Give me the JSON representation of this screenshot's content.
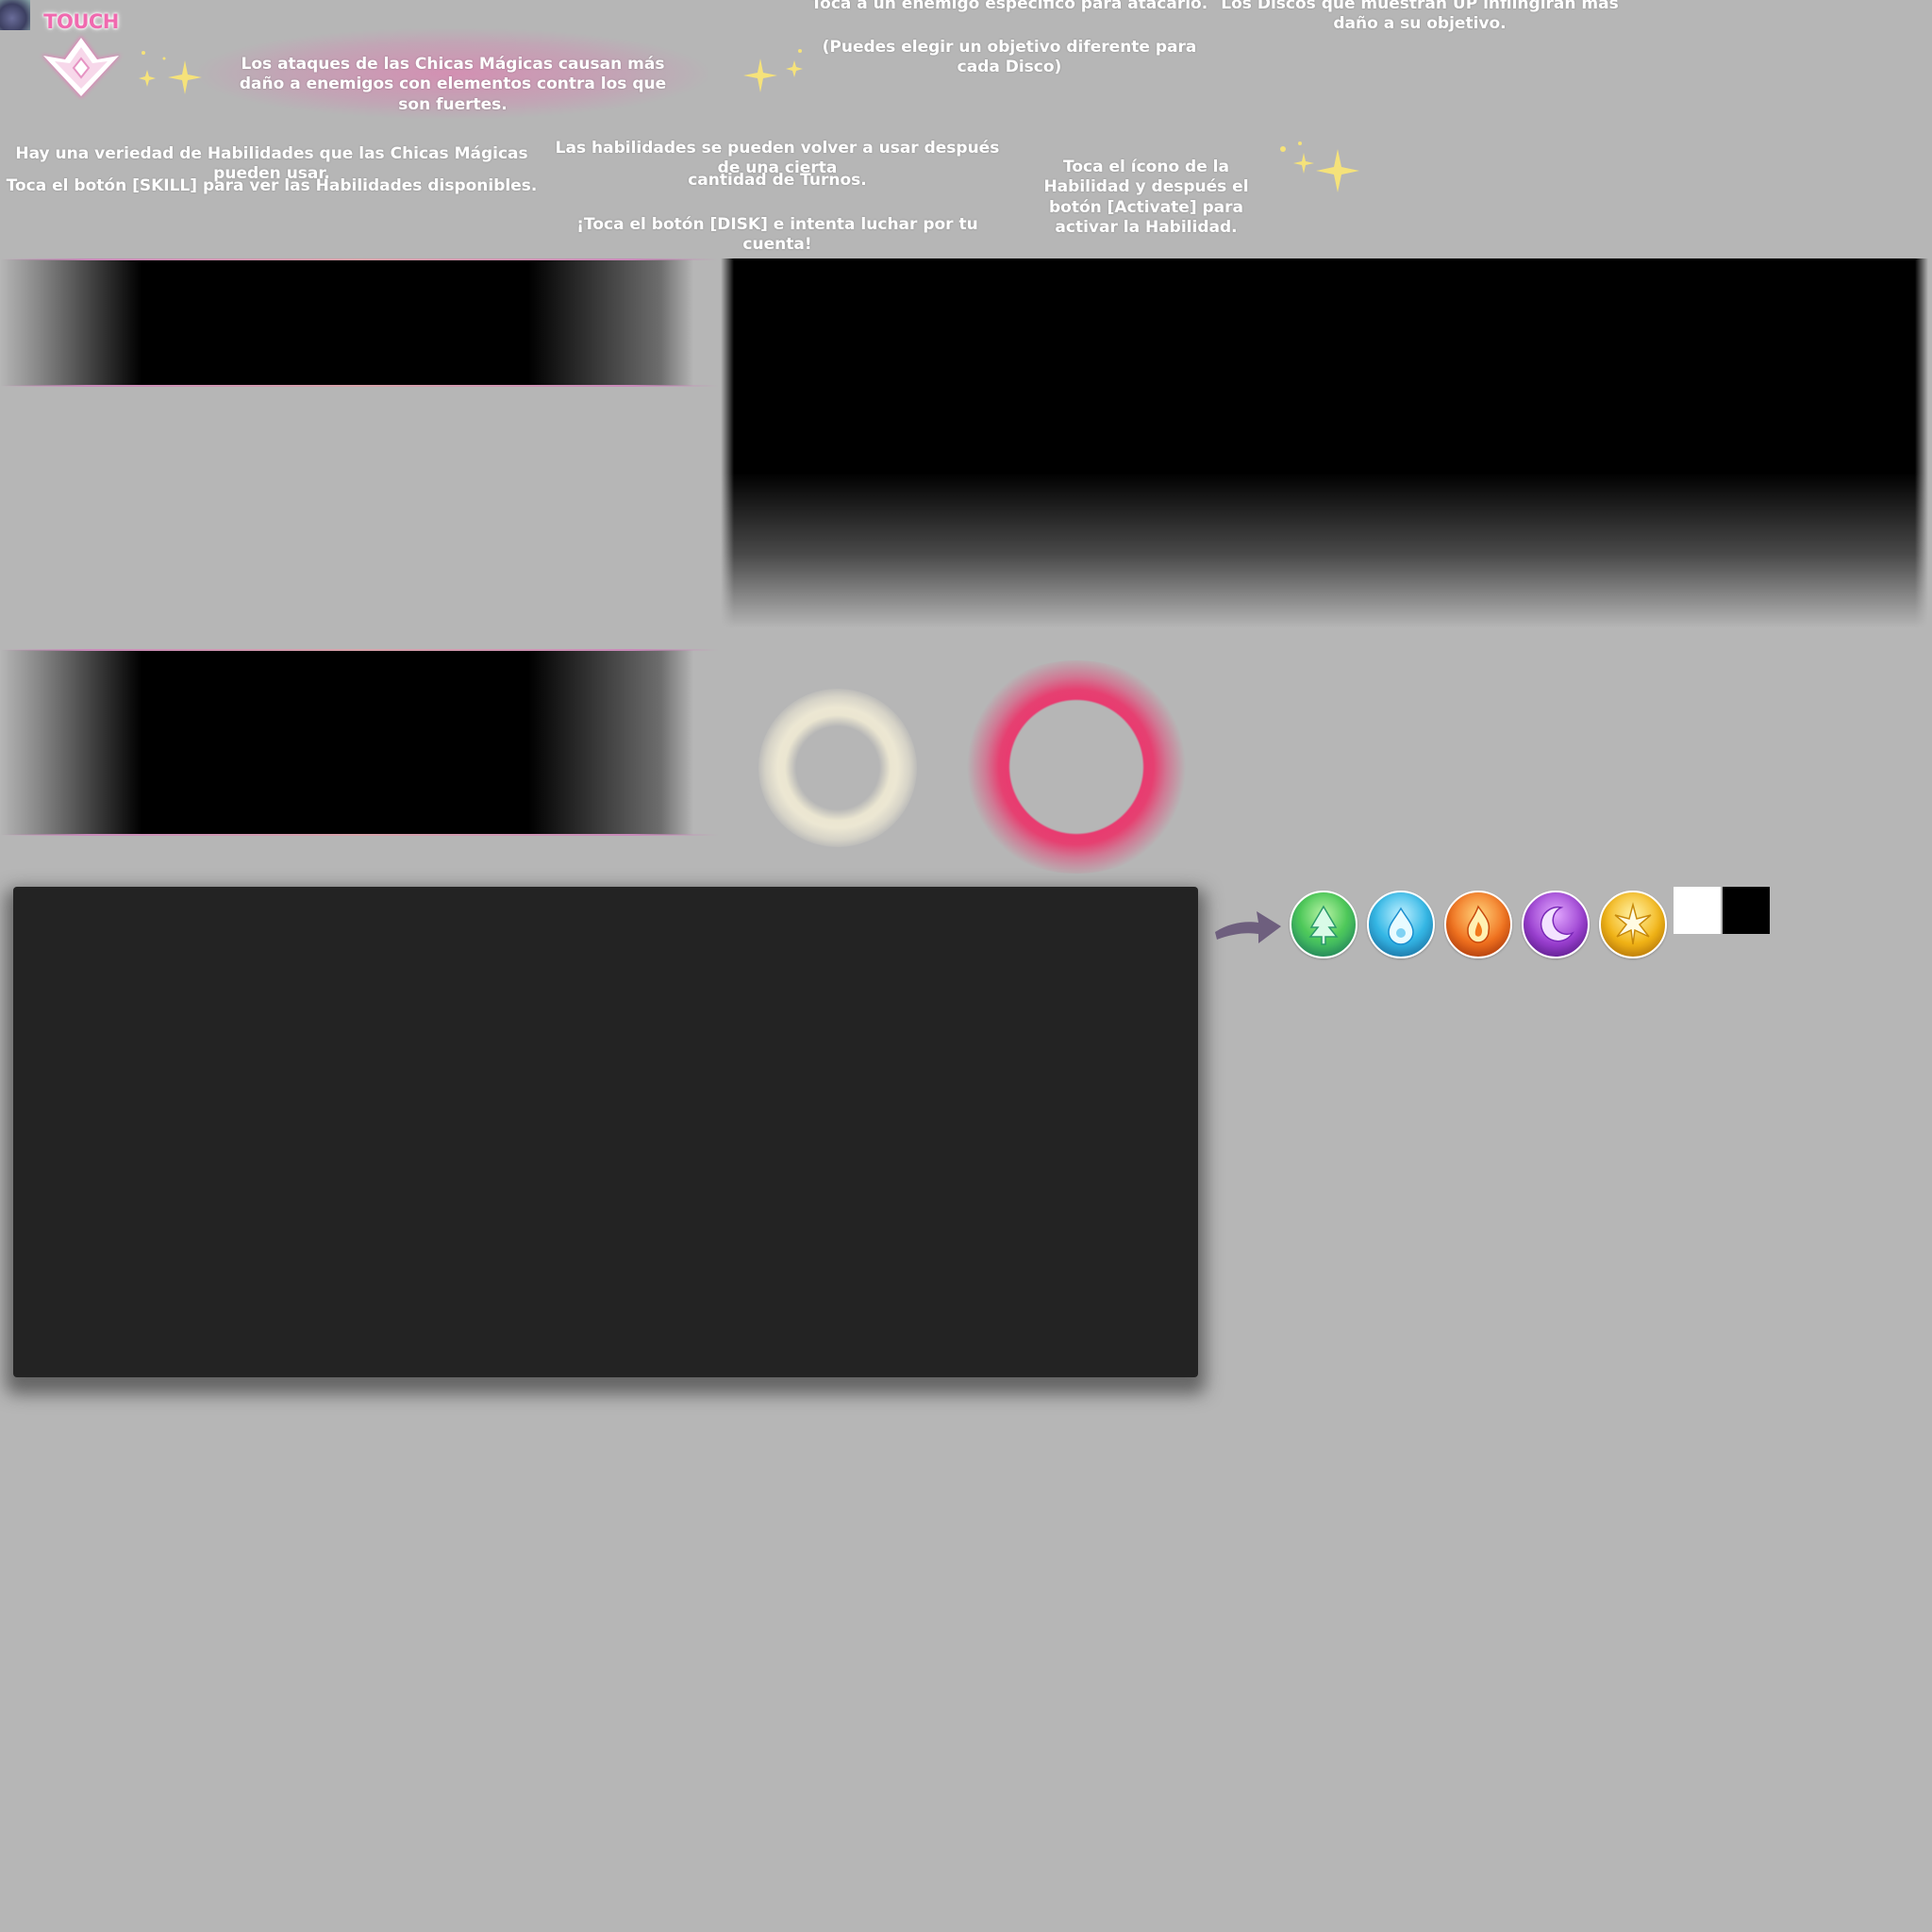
{
  "header": {
    "touch_label": "TOUCH"
  },
  "tips": {
    "element_damage": "Los ataques de las Chicas Mágicas causan más daño a enemigos con elementos contra los que son fuertes.",
    "tap_enemy": "Toca a un enemigo específico para atacarlo.",
    "choose_target": "(Puedes elegir un objetivo diferente para cada Disco)",
    "disc_up": "Los Discos que muestran UP inflingirán más daño a su objetivo.",
    "skills_variety": "Hay una veriedad de Habilidades que las Chicas Mágicas pueden usar.",
    "skill_button": "Toca el botón [SKILL] para ver las Habilidades disponibles.",
    "skills_cooldown_1": "Las habilidades se pueden volver a usar después de una cierta",
    "skills_cooldown_2": "cantidad de Turnos.",
    "disk_button": "¡Toca el botón [DISK] e intenta luchar por tu cuenta!",
    "activate_skill": "Toca el ícono de la Habilidad y después el botón [Activate] para activar la Habilidad."
  },
  "elements": [
    {
      "name": "forest-orb-icon",
      "color": "#4fc95a"
    },
    {
      "name": "water-orb-icon",
      "color": "#35b8e6"
    },
    {
      "name": "fire-orb-icon",
      "color": "#f0701e"
    },
    {
      "name": "dark-orb-icon",
      "color": "#9a3fd0"
    },
    {
      "name": "light-orb-icon",
      "color": "#f2b416"
    }
  ],
  "colors": {
    "background": "#b6b6b6",
    "accent_pink": "#f06aaf",
    "ring_red": "#e83b70",
    "ring_cream": "#ece7d3",
    "dark_panel": "#232323",
    "arrow": "#6e5f7e"
  }
}
